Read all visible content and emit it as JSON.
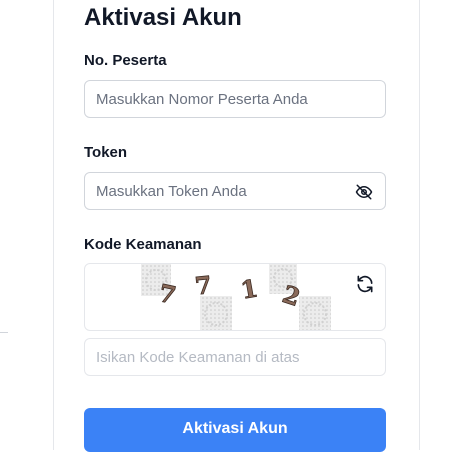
{
  "form": {
    "title": "Aktivasi Akun",
    "peserta": {
      "label": "No. Peserta",
      "placeholder": "Masukkan Nomor Peserta Anda",
      "value": ""
    },
    "token": {
      "label": "Token",
      "placeholder": "Masukkan Token Anda",
      "value": ""
    },
    "captcha": {
      "label": "Kode Keamanan",
      "code": "7712",
      "input_placeholder": "Isikan Kode Keamanan di atas",
      "input_value": ""
    },
    "submit_label": "Aktivasi Akun"
  },
  "icons": {
    "visibility_toggle": "eye-slash-icon",
    "refresh": "refresh-icon"
  },
  "colors": {
    "primary": "#3b82f6",
    "text": "#111827",
    "placeholder": "#6b7280",
    "border": "#d1d5db"
  }
}
